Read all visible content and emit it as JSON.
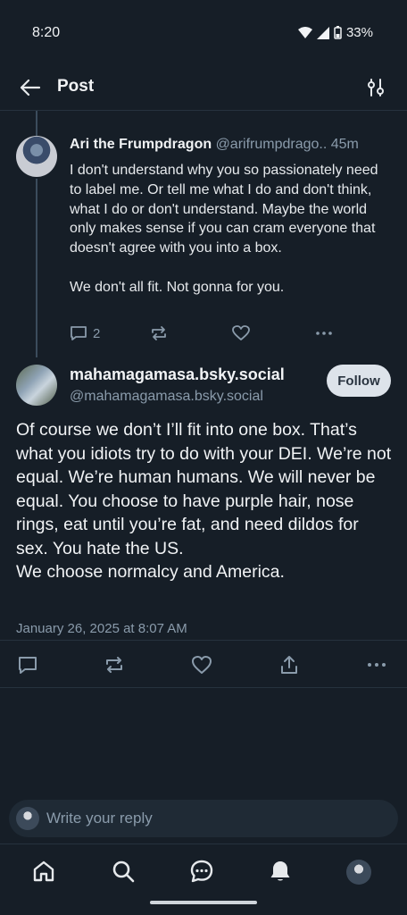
{
  "status": {
    "time": "8:20",
    "battery": "33%"
  },
  "header": {
    "title": "Post"
  },
  "parent": {
    "name": "Ari the Frumpdragon",
    "handle": "@arifrumpdrago..",
    "time": "45m",
    "text": "I don't understand why you so passionately need to label me. Or tell me what I do and don't think, what I do or don't understand. Maybe the world only makes sense if you can cram everyone that doesn't agree with you into a box.\n\nWe don't all fit. Not gonna for you.",
    "reply_count": "2"
  },
  "post": {
    "name": "mahamagamasa.bsky.social",
    "handle": "@mahamagamasa.bsky.social",
    "follow_label": "Follow",
    "text": "Of course we don’t I’ll fit into one box. That’s what you idiots try to do with your DEI. We’re not equal. We’re human humans. We will never be equal. You choose to have purple hair, nose rings, eat until you’re fat, and need dildos for sex. You hate the US.\nWe choose normalcy and America.",
    "date": "January 26, 2025 at 8:07 AM"
  },
  "reply": {
    "placeholder": "Write your reply"
  },
  "icons": {
    "back": "arrow-left-icon",
    "filter": "sliders-icon",
    "reply": "comment-icon",
    "repost": "repost-icon",
    "like": "heart-icon",
    "share": "share-icon",
    "more": "more-icon",
    "home": "home-icon",
    "search": "search-icon",
    "chat": "chat-icon",
    "notifications": "bell-icon"
  },
  "colors": {
    "background": "#161e27",
    "muted": "#8a9bab",
    "follow_bg": "#dde3ea"
  }
}
